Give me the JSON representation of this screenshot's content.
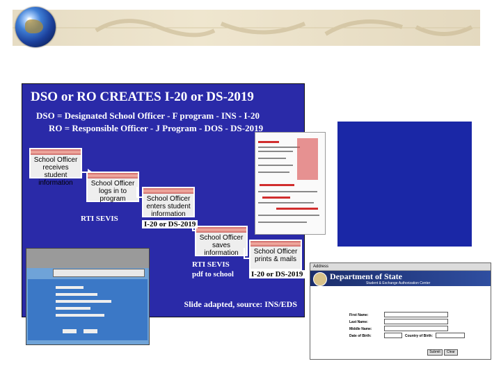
{
  "slide": {
    "title": "DSO or RO CREATES I-20 or DS-2019",
    "line1": "DSO = Designated School Officer - F program - INS - I-20",
    "line2": "RO = Responsible Officer - J Program - DOS - DS-2019",
    "steps": [
      "School Officer receives student information",
      "School Officer logs in to program",
      "School Officer enters student information",
      "School Officer saves information",
      "School Officer prints & mails"
    ],
    "captions": {
      "rti_sevis_1": "RTI SEVIS",
      "form_1": "I-20 or DS-2019",
      "rti_sevis_2": "RTI SEVIS",
      "pdf_to_school": "pdf to school",
      "form_2": "I-20 or DS-2019"
    },
    "source": "Slide adapted, source: INS/EDS"
  },
  "dos_screen": {
    "address_label": "Address",
    "department": "Department of State",
    "subtitle": "Student & Exchange Authorization Center",
    "fields": [
      "First Name:",
      "Last Name:",
      "Middle Name:",
      "Date of Birth:",
      "Country of Birth:"
    ],
    "buttons": [
      "Submit",
      "Clear"
    ]
  },
  "colors": {
    "slide_bg": "#2a2aa8",
    "right_box": "#1a27a6"
  }
}
